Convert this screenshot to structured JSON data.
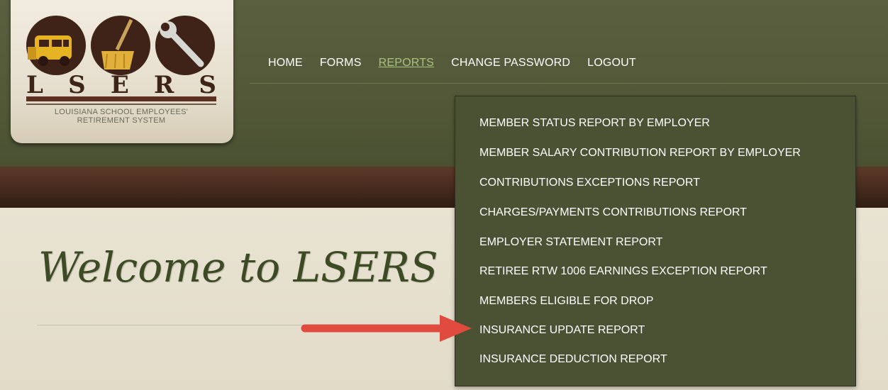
{
  "logo": {
    "letters": [
      "L",
      "S",
      "E",
      "R",
      "S"
    ],
    "name_line1": "LOUISIANA SCHOOL EMPLOYEES'",
    "name_line2": "RETIREMENT SYSTEM",
    "icons": [
      "school-bus-icon",
      "broom-icon",
      "wrench-icon"
    ]
  },
  "nav": {
    "home": "HOME",
    "forms": "FORMS",
    "reports": "REPORTS",
    "change_password": "CHANGE PASSWORD",
    "logout": "LOGOUT",
    "active": "REPORTS"
  },
  "reports_menu": {
    "items": [
      "MEMBER STATUS REPORT BY EMPLOYER",
      "MEMBER SALARY CONTRIBUTION REPORT BY EMPLOYER",
      "CONTRIBUTIONS EXCEPTIONS REPORT",
      "CHARGES/PAYMENTS CONTRIBUTIONS REPORT",
      "EMPLOYER STATEMENT REPORT",
      "RETIREE RTW 1006 EARNINGS EXCEPTION REPORT",
      "MEMBERS ELIGIBLE FOR DROP",
      "INSURANCE UPDATE REPORT",
      "INSURANCE DEDUCTION REPORT"
    ]
  },
  "main": {
    "welcome_text": "Welcome to LSERS"
  },
  "colors": {
    "header_green": "#535938",
    "brown_band": "#4a2d1f",
    "nav_active": "#a9c27e",
    "dropdown_bg": "#4b5133",
    "arrow_red": "#e04a3f"
  }
}
